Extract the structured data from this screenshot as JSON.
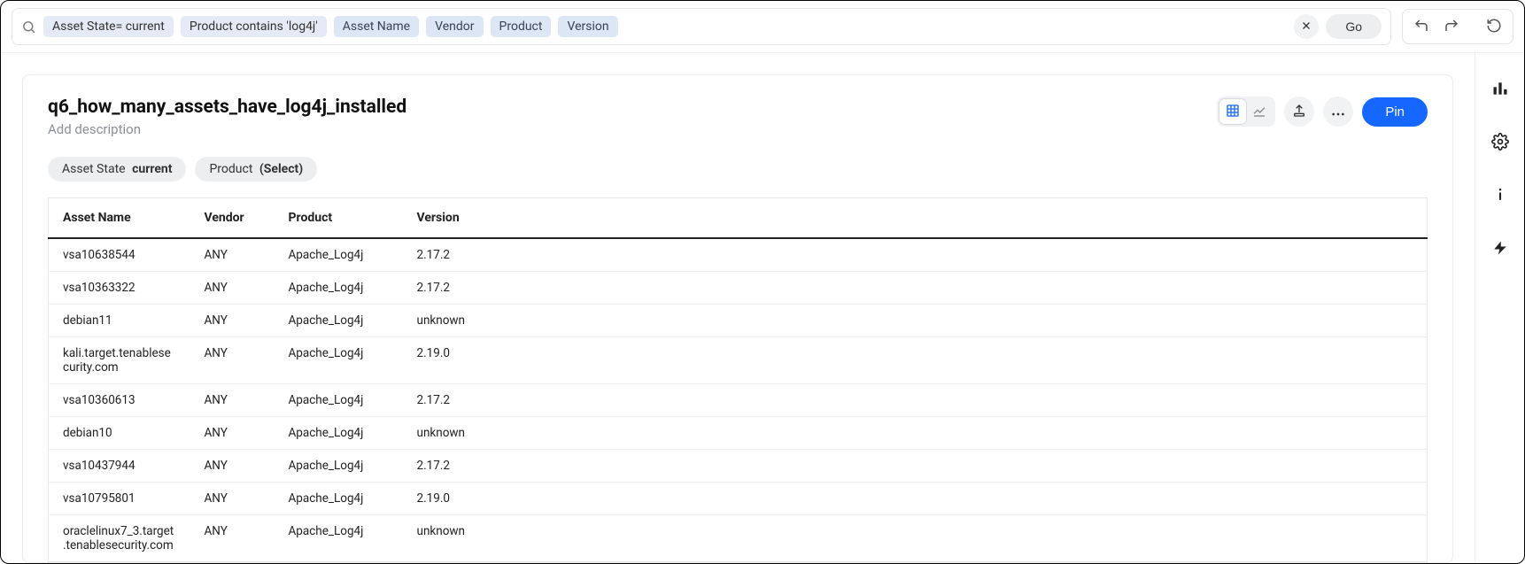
{
  "search": {
    "chips": [
      "Asset State= current",
      "Product contains 'log4j'",
      "Asset Name",
      "Vendor",
      "Product",
      "Version"
    ],
    "go_label": "Go"
  },
  "page": {
    "title": "q6_how_many_assets_have_log4j_installed",
    "description_placeholder": "Add description",
    "pin_label": "Pin"
  },
  "filters": [
    {
      "label": "Asset State",
      "value": "current"
    },
    {
      "label": "Product",
      "value": "(Select)"
    }
  ],
  "table": {
    "columns": [
      "Asset Name",
      "Vendor",
      "Product",
      "Version"
    ],
    "rows": [
      {
        "asset_name": "vsa10638544",
        "vendor": "ANY",
        "product": "Apache_Log4j",
        "version": "2.17.2"
      },
      {
        "asset_name": "vsa10363322",
        "vendor": "ANY",
        "product": "Apache_Log4j",
        "version": "2.17.2"
      },
      {
        "asset_name": "debian11",
        "vendor": "ANY",
        "product": "Apache_Log4j",
        "version": "unknown"
      },
      {
        "asset_name": "kali.target.tenablesecurity.com",
        "vendor": "ANY",
        "product": "Apache_Log4j",
        "version": "2.19.0"
      },
      {
        "asset_name": "vsa10360613",
        "vendor": "ANY",
        "product": "Apache_Log4j",
        "version": "2.17.2"
      },
      {
        "asset_name": "debian10",
        "vendor": "ANY",
        "product": "Apache_Log4j",
        "version": "unknown"
      },
      {
        "asset_name": "vsa10437944",
        "vendor": "ANY",
        "product": "Apache_Log4j",
        "version": "2.17.2"
      },
      {
        "asset_name": "vsa10795801",
        "vendor": "ANY",
        "product": "Apache_Log4j",
        "version": "2.19.0"
      },
      {
        "asset_name": "oraclelinux7_3.target.tenablesecurity.com",
        "vendor": "ANY",
        "product": "Apache_Log4j",
        "version": "unknown"
      }
    ]
  }
}
